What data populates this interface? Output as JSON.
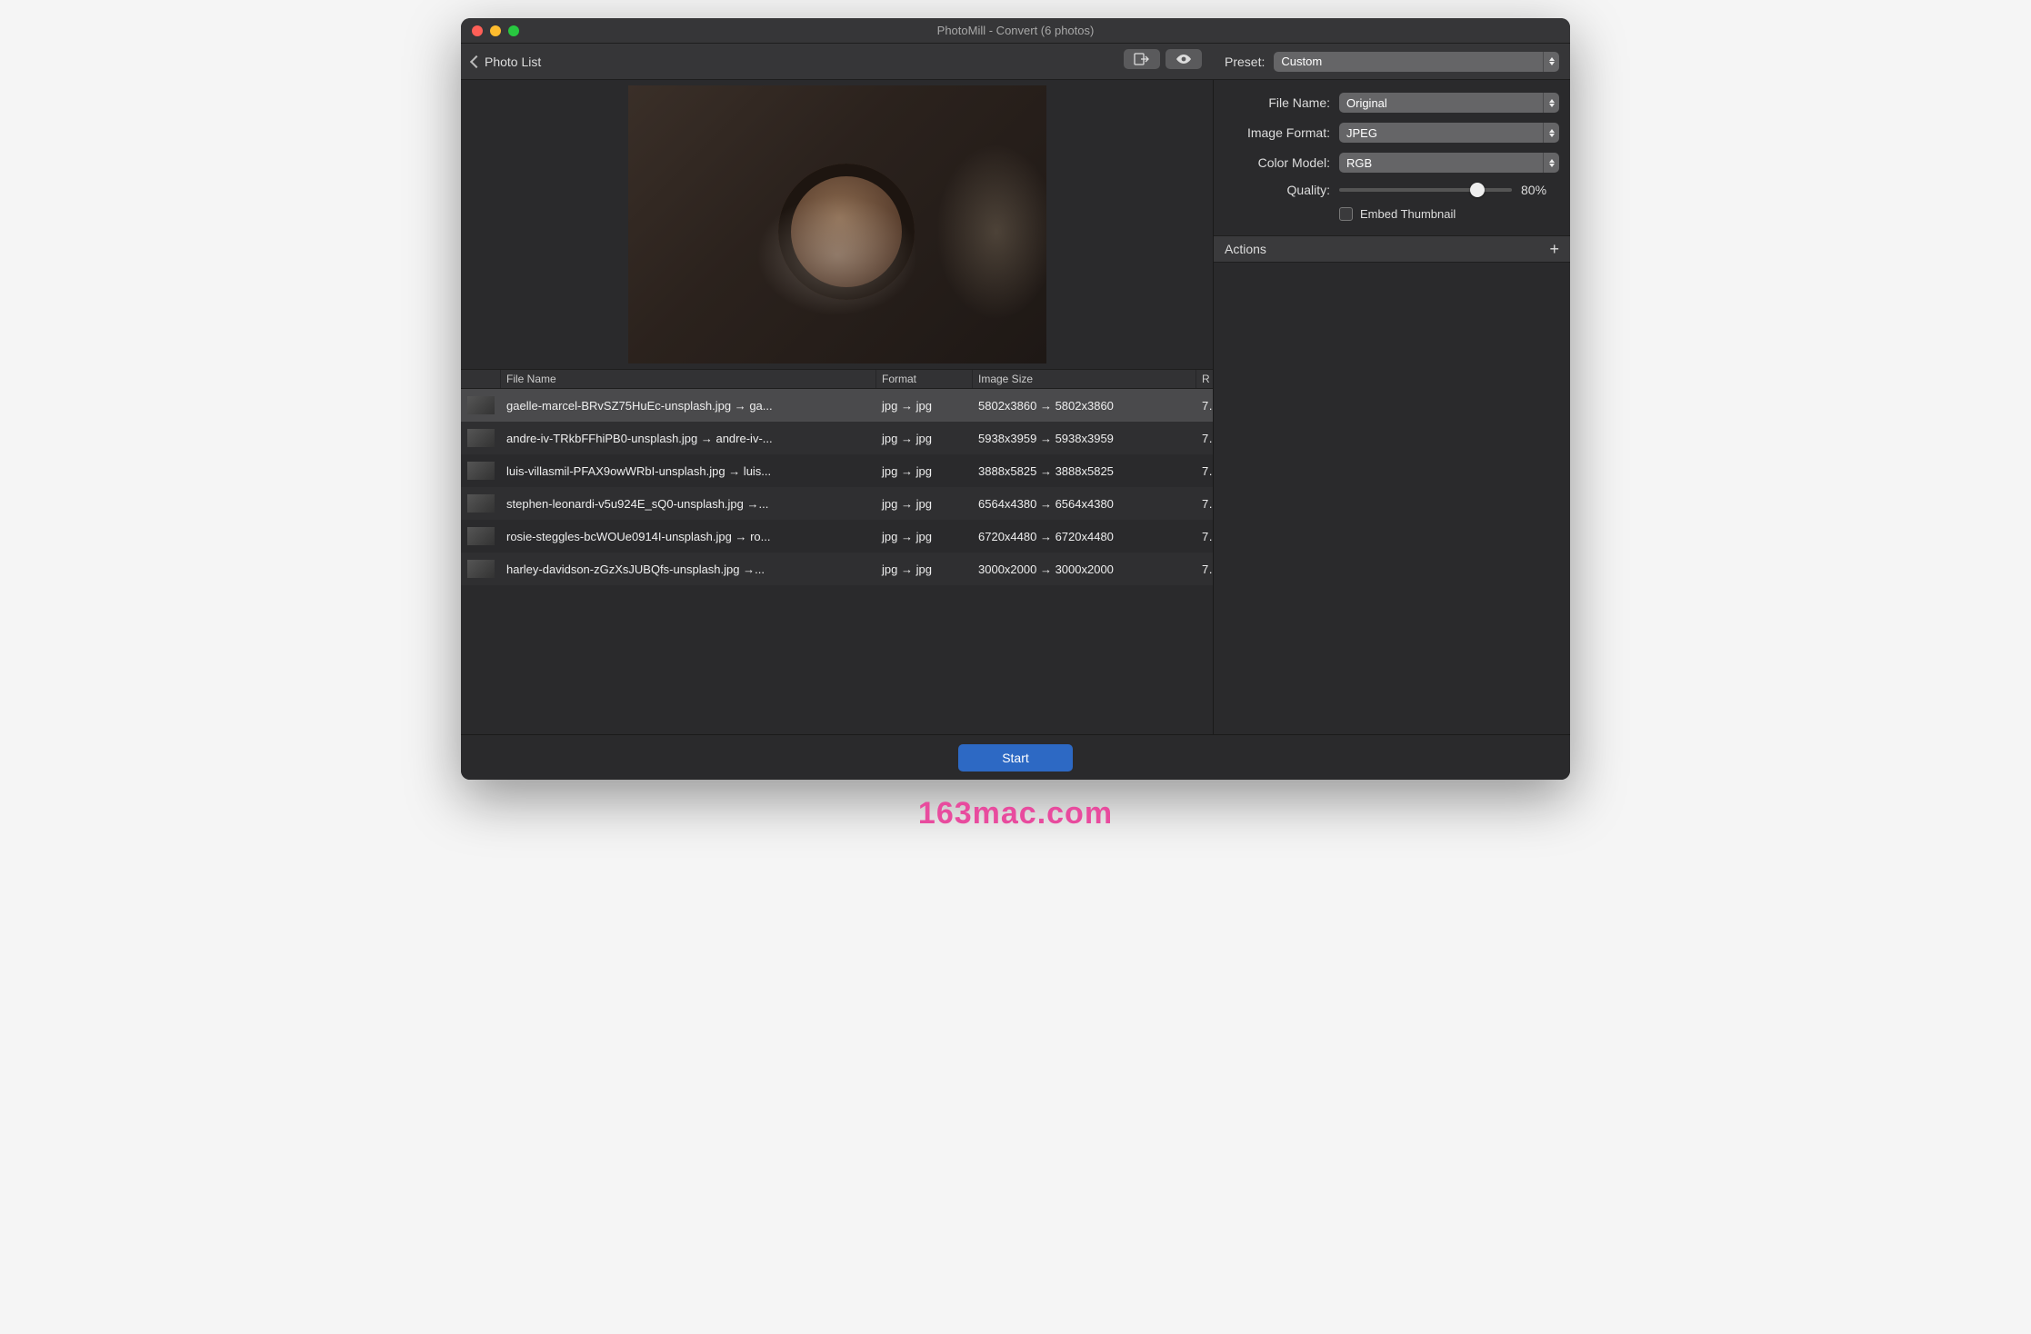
{
  "window": {
    "title": "PhotoMill - Convert (6 photos)"
  },
  "toolbar": {
    "back_label": "Photo List"
  },
  "preview": {
    "icon": "preview-image"
  },
  "table": {
    "headers": {
      "filename": "File Name",
      "format": "Format",
      "imagesize": "Image Size",
      "rest": "R"
    },
    "rows": [
      {
        "selected": true,
        "name": "gaelle-marcel-BRvSZ75HuEc-unsplash.jpg → ga...",
        "format": "jpg → jpg",
        "size": "5802x3860 → 5802x3860",
        "rest": "7"
      },
      {
        "selected": false,
        "name": "andre-iv-TRkbFFhiPB0-unsplash.jpg → andre-iv-...",
        "format": "jpg → jpg",
        "size": "5938x3959 → 5938x3959",
        "rest": "7"
      },
      {
        "selected": false,
        "name": "luis-villasmil-PFAX9owWRbI-unsplash.jpg → luis...",
        "format": "jpg → jpg",
        "size": "3888x5825 → 3888x5825",
        "rest": "7"
      },
      {
        "selected": false,
        "name": "stephen-leonardi-v5u924E_sQ0-unsplash.jpg →...",
        "format": "jpg → jpg",
        "size": "6564x4380 → 6564x4380",
        "rest": "7"
      },
      {
        "selected": false,
        "name": "rosie-steggles-bcWOUe0914I-unsplash.jpg → ro...",
        "format": "jpg → jpg",
        "size": "6720x4480 → 6720x4480",
        "rest": "7"
      },
      {
        "selected": false,
        "name": "harley-davidson-zGzXsJUBQfs-unsplash.jpg →...",
        "format": "jpg → jpg",
        "size": "3000x2000 → 3000x2000",
        "rest": "7"
      }
    ]
  },
  "footer": {
    "start_label": "Start"
  },
  "sidebar": {
    "preset_label": "Preset:",
    "preset_value": "Custom",
    "filename_label": "File Name:",
    "filename_value": "Original",
    "format_label": "Image Format:",
    "format_value": "JPEG",
    "colormodel_label": "Color Model:",
    "colormodel_value": "RGB",
    "quality_label": "Quality:",
    "quality_value": "80%",
    "quality_pct": 80,
    "embed_label": "Embed Thumbnail",
    "actions_label": "Actions"
  },
  "watermark": "163mac.com"
}
